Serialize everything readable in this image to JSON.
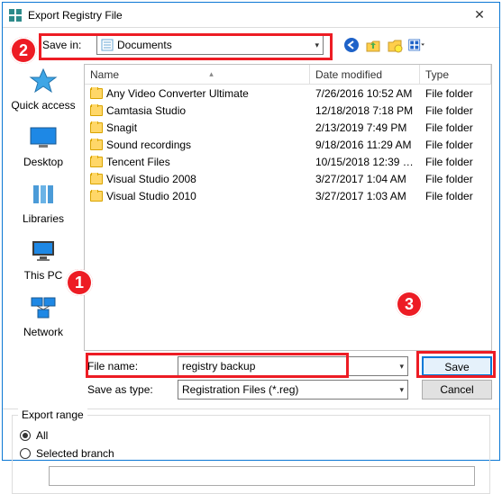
{
  "window": {
    "title": "Export Registry File",
    "close": "✕"
  },
  "savein": {
    "label": "Save in:",
    "value": "Documents"
  },
  "columns": {
    "name": "Name",
    "date": "Date modified",
    "type": "Type"
  },
  "files": [
    {
      "name": "Any Video Converter Ultimate",
      "date": "7/26/2016 10:52 AM",
      "type": "File folder"
    },
    {
      "name": "Camtasia Studio",
      "date": "12/18/2018 7:18 PM",
      "type": "File folder"
    },
    {
      "name": "Snagit",
      "date": "2/13/2019 7:49 PM",
      "type": "File folder"
    },
    {
      "name": "Sound recordings",
      "date": "9/18/2016 11:29 AM",
      "type": "File folder"
    },
    {
      "name": "Tencent Files",
      "date": "10/15/2018 12:39 …",
      "type": "File folder"
    },
    {
      "name": "Visual Studio 2008",
      "date": "3/27/2017 1:04 AM",
      "type": "File folder"
    },
    {
      "name": "Visual Studio 2010",
      "date": "3/27/2017 1:03 AM",
      "type": "File folder"
    }
  ],
  "places": {
    "quick": "Quick access",
    "desktop": "Desktop",
    "libs": "Libraries",
    "thispc": "This PC",
    "network": "Network"
  },
  "filename": {
    "label": "File name:",
    "value": "registry backup"
  },
  "savetype": {
    "label": "Save as type:",
    "value": "Registration Files (*.reg)"
  },
  "buttons": {
    "save": "Save",
    "cancel": "Cancel"
  },
  "range": {
    "legend": "Export range",
    "all": "All",
    "selected": "Selected branch"
  },
  "badges": {
    "one": "1",
    "two": "2",
    "three": "3"
  }
}
